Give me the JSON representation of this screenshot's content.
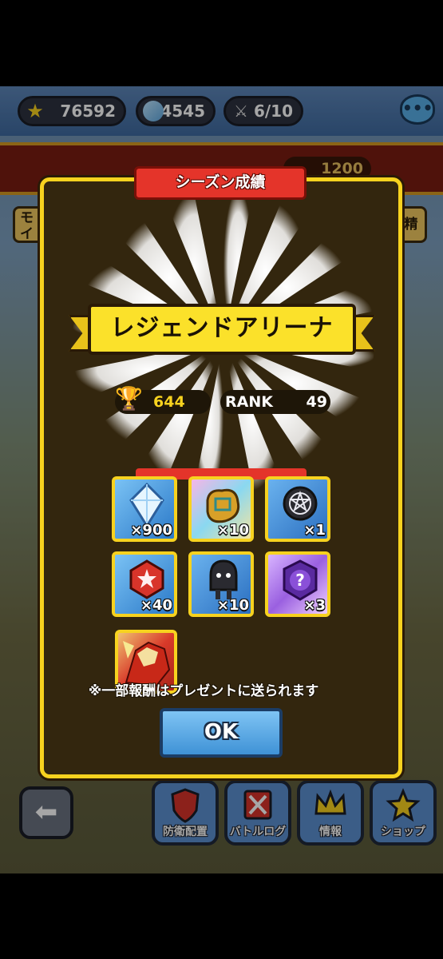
{
  "status_bar": {
    "stamina": "76592",
    "gems": "44545",
    "battles": "6/10"
  },
  "background": {
    "arena_trophies": "1200",
    "left_tab": "モ\nイ",
    "right_tab": "精",
    "nav": [
      {
        "label": "防衛配置",
        "icon": "shield-icon"
      },
      {
        "label": "バトルログ",
        "icon": "crossed-swords-icon"
      },
      {
        "label": "情報",
        "icon": "crown-icon"
      },
      {
        "label": "ショップ",
        "icon": "star-medal-icon"
      }
    ]
  },
  "modal": {
    "title": "シーズン成績",
    "league_name": "レジェンドアリーナ",
    "trophies": "644",
    "rank_label": "RANK",
    "rank_value": "49",
    "rewards": [
      {
        "icon": "crystal-icon",
        "qty": "×900"
      },
      {
        "icon": "gold-medal-icon",
        "qty": "×10"
      },
      {
        "icon": "magic-seal-icon",
        "qty": "×1"
      },
      {
        "icon": "red-gem-icon",
        "qty": "×40"
      },
      {
        "icon": "shadow-figure-icon",
        "qty": "×10"
      },
      {
        "icon": "mystery-orb-icon",
        "qty": "×3"
      },
      {
        "icon": "character-card-icon",
        "qty": ""
      }
    ],
    "note": "※一部報酬はプレゼントに送られます",
    "ok_label": "OK"
  },
  "colors": {
    "modal_border": "#f7d21f",
    "modal_bg": "#33260e",
    "title_tab": "#e4342a",
    "ribbon": "#fbe12a",
    "ok_button": "#3f92d6"
  }
}
